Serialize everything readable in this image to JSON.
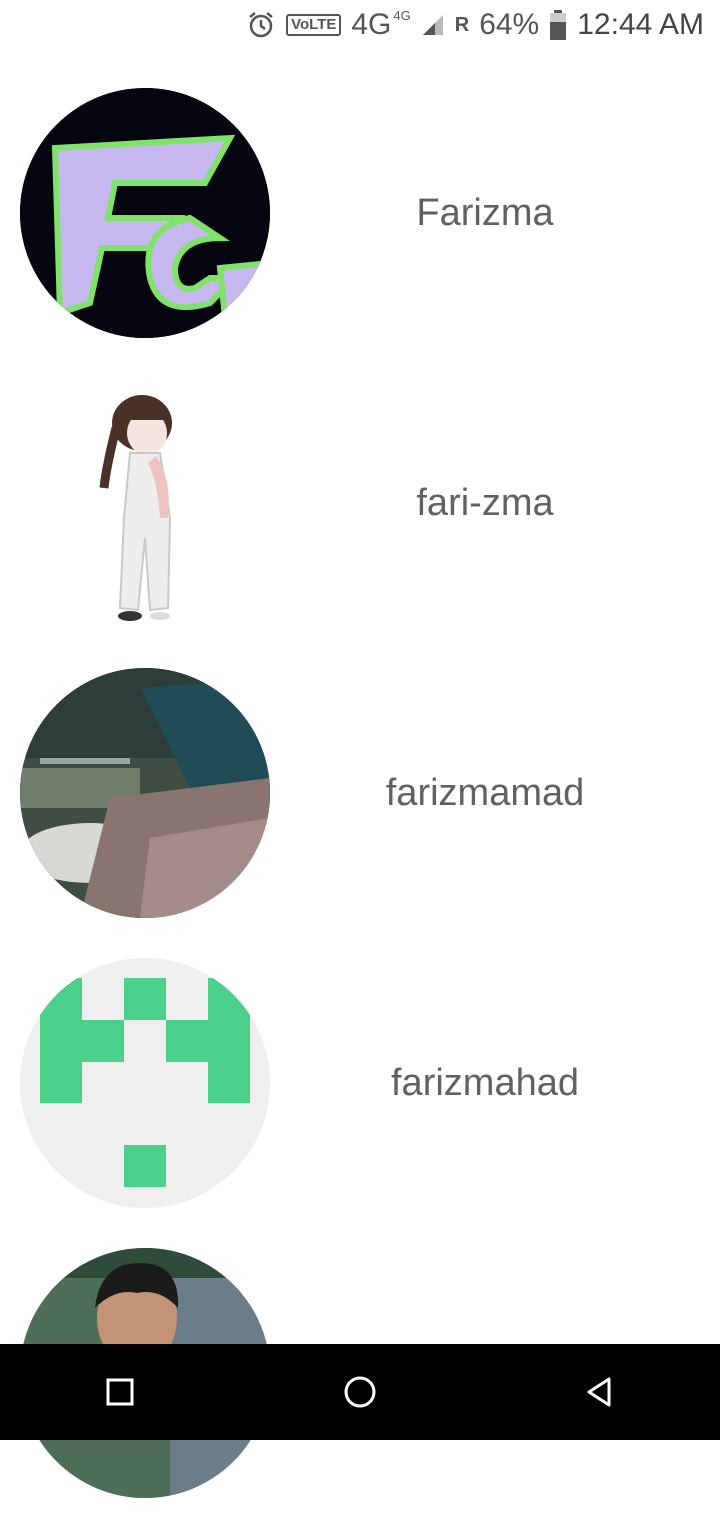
{
  "status_bar": {
    "alarm_icon": "alarm-clock-icon",
    "volte": "VoLTE",
    "network": "4G",
    "network_small": "4G",
    "roaming": "R",
    "battery_percent": "64%",
    "time": "12:44 AM"
  },
  "accounts": [
    {
      "name": "Farizma",
      "avatar": "fg-logo-avatar"
    },
    {
      "name": "fari-zma",
      "avatar": "cartoon-girl-avatar"
    },
    {
      "name": "farizmamad",
      "avatar": "river-photo-avatar"
    },
    {
      "name": "farizmahad",
      "avatar": "green-identicon-avatar"
    },
    {
      "name": "",
      "avatar": "person-photo-avatar"
    }
  ],
  "nav_bar": {
    "recents_icon": "square-recents-icon",
    "home_icon": "circle-home-icon",
    "back_icon": "triangle-back-icon"
  }
}
